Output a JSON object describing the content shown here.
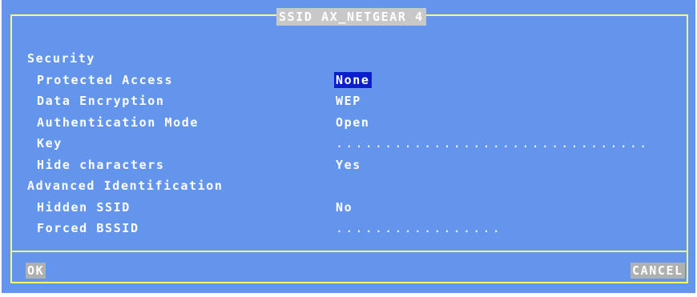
{
  "dialog": {
    "title": "SSID AX_NETGEAR 4"
  },
  "sections": {
    "security": "Security",
    "advanced": "Advanced Identification"
  },
  "fields": {
    "protected_access": {
      "label": "Protected Access",
      "value": "None"
    },
    "data_encryption": {
      "label": "Data Encryption",
      "value": "WEP"
    },
    "auth_mode": {
      "label": "Authentication Mode",
      "value": "Open"
    },
    "key": {
      "label": "Key",
      "value": "................................"
    },
    "hide_chars": {
      "label": "Hide characters",
      "value": "Yes"
    },
    "hidden_ssid": {
      "label": "Hidden SSID",
      "value": "No"
    },
    "forced_bssid": {
      "label": "Forced BSSID",
      "value": "................."
    }
  },
  "buttons": {
    "ok": "OK",
    "cancel": "CANCEL"
  },
  "colors": {
    "background": "#6495ed",
    "frame": "#ffff66",
    "selection": "#0a1fc8",
    "button": "#b0b0b0"
  }
}
